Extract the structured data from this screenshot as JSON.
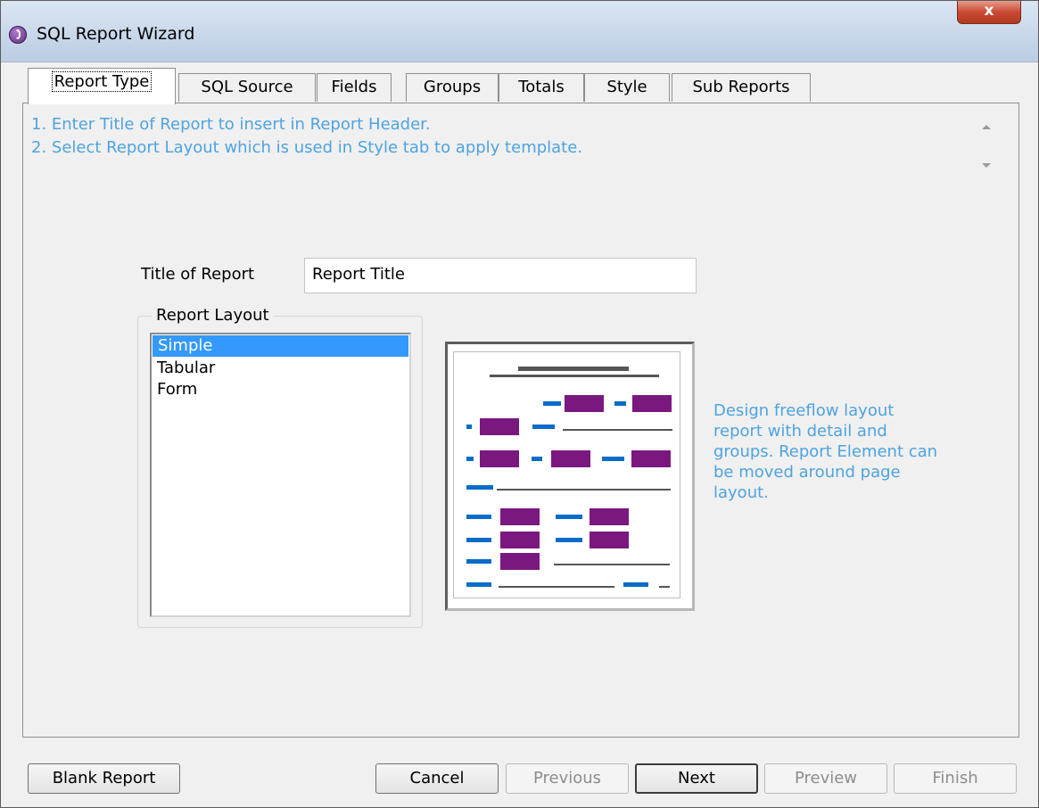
{
  "window": {
    "title": "SQL Report Wizard",
    "close_label": "x"
  },
  "tabs": [
    {
      "label": "Report Type",
      "active": true
    },
    {
      "label": "SQL Source"
    },
    {
      "label": "Fields"
    },
    {
      "label": "Groups"
    },
    {
      "label": "Totals"
    },
    {
      "label": "Style"
    },
    {
      "label": "Sub Reports"
    }
  ],
  "instructions": [
    "1. Enter Title of Report to insert in Report Header.",
    "2. Select Report Layout which is used in Style tab to apply template."
  ],
  "title_field": {
    "label": "Title of Report",
    "value": "Report Title"
  },
  "layout_group": {
    "legend": "Report Layout",
    "items": [
      "Simple",
      "Tabular",
      "Form"
    ],
    "selected": "Simple"
  },
  "description": "Design freeflow layout report with detail and groups. Report Element can be moved around page layout.",
  "buttons": {
    "blank_report": "Blank Report",
    "cancel": "Cancel",
    "previous": "Previous",
    "next": "Next",
    "preview": "Preview",
    "finish": "Finish"
  },
  "colors": {
    "instruction_text": "#4ea3e0",
    "preview_label": "#0a6cc8",
    "preview_field": "#7b1880",
    "selection": "#3399ff"
  }
}
